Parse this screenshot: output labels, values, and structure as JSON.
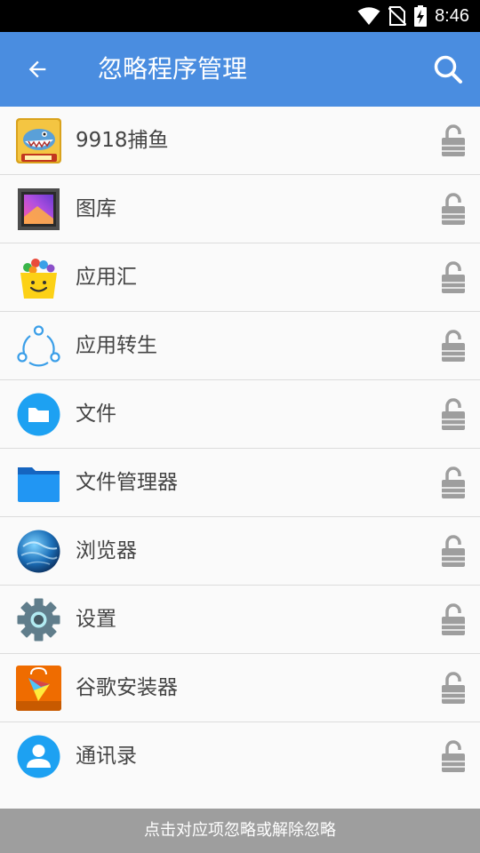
{
  "status_bar": {
    "time": "8:46"
  },
  "app_bar": {
    "title": "忽略程序管理"
  },
  "apps": [
    {
      "name": "9918捕鱼"
    },
    {
      "name": "图库"
    },
    {
      "name": "应用汇"
    },
    {
      "name": "应用转生"
    },
    {
      "name": "文件"
    },
    {
      "name": "文件管理器"
    },
    {
      "name": "浏览器"
    },
    {
      "name": "设置"
    },
    {
      "name": "谷歌安装器"
    },
    {
      "name": "通讯录"
    }
  ],
  "icons": {
    "back": "arrow-back-icon",
    "search": "search-icon",
    "lock": "lock-open-icon"
  },
  "colors": {
    "accent": "#4a8de0",
    "footer": "#9e9e9e"
  },
  "footer": {
    "hint": "点击对应项忽略或解除忽略"
  }
}
